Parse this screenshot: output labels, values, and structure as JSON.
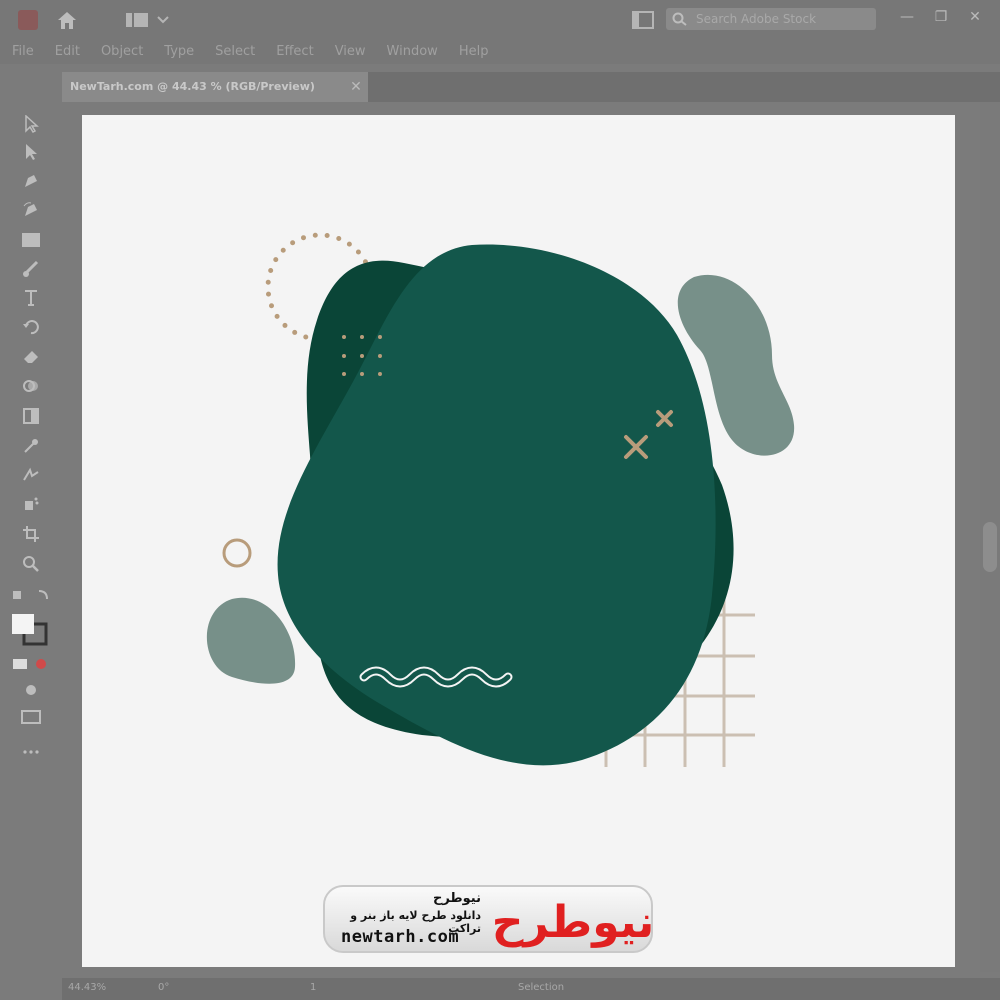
{
  "app": {
    "menu": [
      "File",
      "Edit",
      "Object",
      "Type",
      "Select",
      "Effect",
      "View",
      "Window",
      "Help"
    ],
    "search_placeholder": "Search Adobe Stock",
    "document_tab": "NewTarh.com @ 44.43 % (RGB/Preview)",
    "tab_close": "✕",
    "window_controls": [
      "—",
      "❐",
      "✕"
    ]
  },
  "status": {
    "zoom": "44.43%",
    "rotation": "0°",
    "artboard_num": "1",
    "mode": "Selection"
  },
  "watermark": {
    "title": "نیوطرح",
    "subtitle": "دانلود طرح لایه باز بنر و تراکت",
    "url": "newtarh.com",
    "logo_text": "نیوطرح"
  },
  "colors": {
    "blob_main": "#13574b",
    "blob_dark": "#0a4537",
    "blob_light": "#779089",
    "accent_tan": "#b89c7b",
    "grid_line": "#cbbfb2",
    "logo_red": "#e02020"
  }
}
